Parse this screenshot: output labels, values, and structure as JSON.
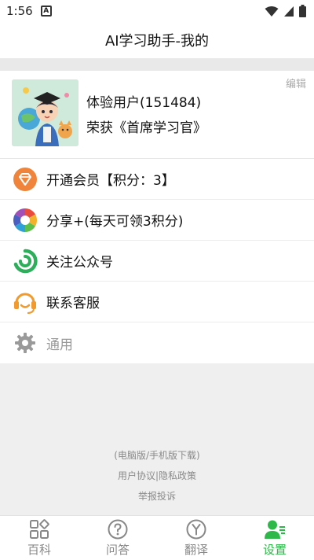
{
  "status_bar": {
    "time": "1:56",
    "badge": "A"
  },
  "header": {
    "title": "AI学习助手-我的"
  },
  "profile": {
    "name": "体验用户(151484)",
    "title": "荣获《首席学习官》",
    "edit_label": "编辑"
  },
  "menu": {
    "items": [
      {
        "label": "开通会员【积分：3】",
        "icon": "diamond-icon"
      },
      {
        "label": "分享+(每天可领3积分)",
        "icon": "aperture-icon"
      },
      {
        "label": "关注公众号",
        "icon": "wechat-official-icon"
      },
      {
        "label": "联系客服",
        "icon": "headset-icon"
      },
      {
        "label": "通用",
        "icon": "gear-icon"
      }
    ]
  },
  "footer": {
    "line1": "(电脑版/手机版下载)",
    "line2": "用户协议|隐私政策",
    "line3": "举报投诉"
  },
  "tabs": [
    {
      "label": "百科",
      "icon": "grid-icon"
    },
    {
      "label": "问答",
      "icon": "question-icon"
    },
    {
      "label": "翻译",
      "icon": "translate-icon"
    },
    {
      "label": "设置",
      "icon": "user-settings-icon",
      "active": true
    }
  ],
  "colors": {
    "accent": "#2fb84a",
    "member_orange": "#f0843a",
    "service_orange": "#f39a2c"
  }
}
